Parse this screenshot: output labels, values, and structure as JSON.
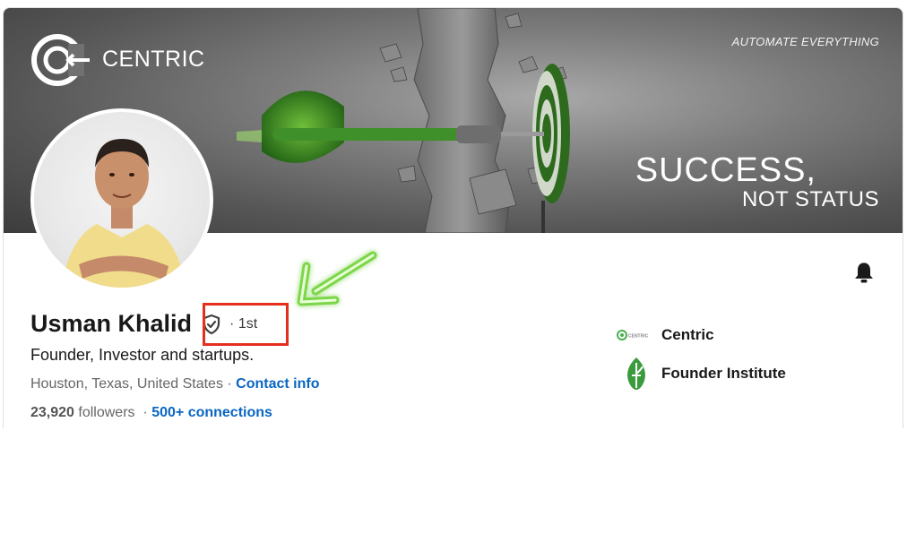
{
  "banner": {
    "logo_text": "CENTRIC",
    "tagline": "AUTOMATE EVERYTHING",
    "headline_line1": "SUCCESS,",
    "headline_line2": "NOT STATUS"
  },
  "profile": {
    "name": "Usman Khalid",
    "degree": "· 1st",
    "headline": "Founder, Investor and startups.",
    "location": "Houston, Texas, United States",
    "separator": " · ",
    "contact_info": "Contact info",
    "followers_count": "23,920",
    "followers_label": "followers",
    "connections_separator": "·",
    "connections": "500+ connections"
  },
  "companies": [
    {
      "name": "Centric",
      "logo_text": "CENTRIC",
      "icon": "centric-logo"
    },
    {
      "name": "Founder Institute",
      "icon": "founder-institute-logo"
    }
  ],
  "icons": {
    "notification": "bell-icon",
    "verification": "shield-check-icon",
    "annotation_arrow": "green-arrow"
  },
  "colors": {
    "link": "#0a66c2",
    "highlight_box": "#e42f1e",
    "arrow": "#7dd64a",
    "dart_green": "#2e7d1e"
  }
}
